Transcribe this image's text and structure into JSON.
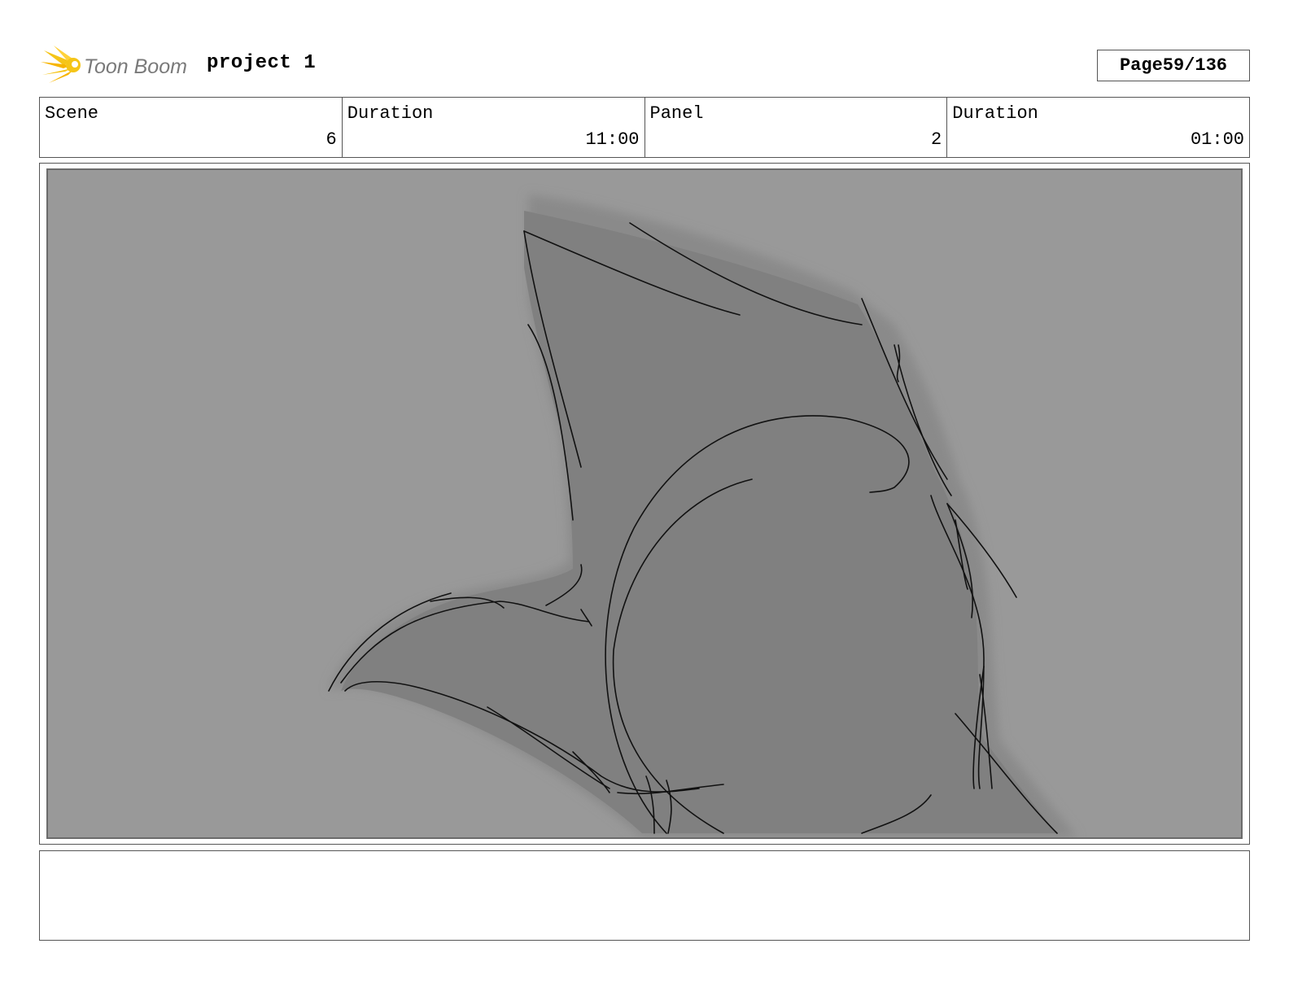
{
  "header": {
    "logo_text": "Toon Boom",
    "project_title": "project 1",
    "page_label": "Page",
    "page_number": "59/136"
  },
  "info": [
    {
      "label": "Scene",
      "value": "6"
    },
    {
      "label": "Duration",
      "value": "11:00"
    },
    {
      "label": "Panel",
      "value": "2"
    },
    {
      "label": "Duration",
      "value": "01:00"
    }
  ],
  "notes": "",
  "colors": {
    "logo_yellow": "#f5c518",
    "logo_text_gray": "#7a7a7a",
    "panel_background": "#999999",
    "sketch_fill": "#808080",
    "sketch_line": "#111111"
  }
}
